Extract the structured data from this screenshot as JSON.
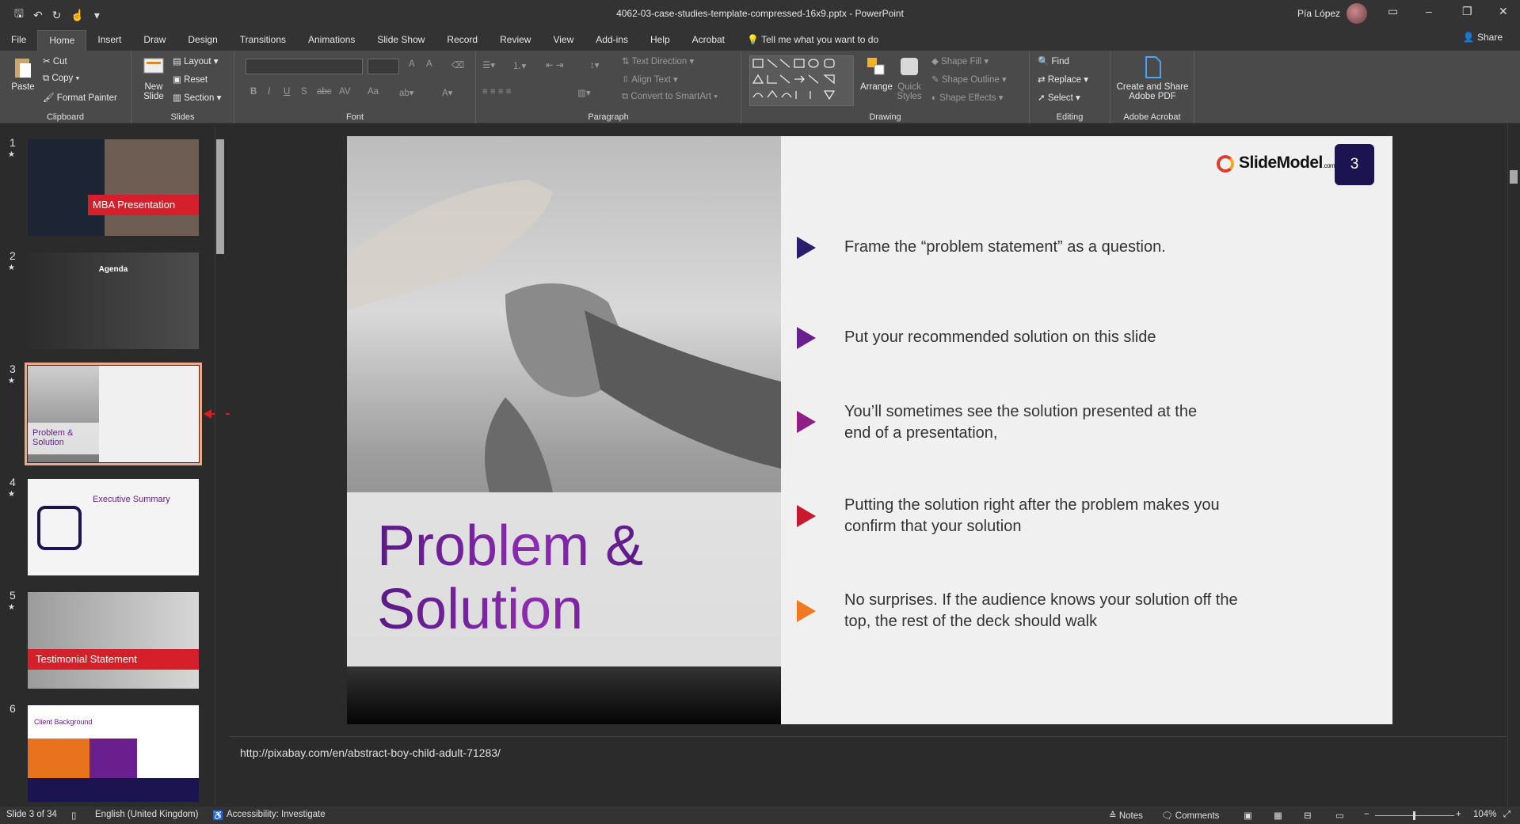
{
  "window": {
    "title": "4062-03-case-studies-template-compressed-16x9.pptx  -  PowerPoint",
    "user": "Pía López"
  },
  "tabs": [
    "File",
    "Home",
    "Insert",
    "Draw",
    "Design",
    "Transitions",
    "Animations",
    "Slide Show",
    "Record",
    "Review",
    "View",
    "Add-ins",
    "Help",
    "Acrobat"
  ],
  "tell_me": "Tell me what you want to do",
  "share": "Share",
  "ribbon": {
    "clipboard": {
      "paste": "Paste",
      "cut": "Cut",
      "copy": "Copy",
      "format_painter": "Format Painter",
      "label": "Clipboard"
    },
    "slides": {
      "new_slide": "New Slide",
      "layout": "Layout",
      "reset": "Reset",
      "section": "Section",
      "label": "Slides"
    },
    "font": {
      "label": "Font",
      "bold": "B",
      "italic": "I",
      "underline": "U",
      "shadow": "S",
      "strike": "abc",
      "spacing": "AV",
      "case": "Aa",
      "grow": "A",
      "shrink": "A"
    },
    "paragraph": {
      "text_direction": "Text Direction",
      "align_text": "Align Text",
      "convert": "Convert to SmartArt",
      "label": "Paragraph"
    },
    "drawing": {
      "arrange": "Arrange",
      "quick_styles": "Quick Styles",
      "shape_fill": "Shape Fill",
      "shape_outline": "Shape Outline",
      "shape_effects": "Shape Effects",
      "label": "Drawing"
    },
    "editing": {
      "find": "Find",
      "replace": "Replace",
      "select": "Select",
      "label": "Editing"
    },
    "acrobat": {
      "create": "Create and Share Adobe PDF",
      "label": "Adobe Acrobat"
    }
  },
  "thumbnails": [
    {
      "num": "1",
      "caption": "MBA Presentation"
    },
    {
      "num": "2",
      "caption": "Agenda"
    },
    {
      "num": "3",
      "caption": "Problem & Solution"
    },
    {
      "num": "4",
      "caption": "Executive Summary"
    },
    {
      "num": "5",
      "caption": "Testimonial Statement"
    },
    {
      "num": "6",
      "caption": "Client Background"
    }
  ],
  "slide": {
    "title_line1": "Problem &",
    "title_line2": "Solution",
    "logo": "SlideModel",
    "logo_suffix": ".com",
    "number": "3",
    "bullets": [
      {
        "text": "Frame the “problem statement” as a question.",
        "color": "#2a1d6e"
      },
      {
        "text": "Put your recommended solution on this slide",
        "color": "#6a1f8e"
      },
      {
        "text": "You’ll sometimes see the solution presented at the end of a presentation,",
        "color": "#8e1f86"
      },
      {
        "text": "Putting the solution right after the problem makes you confirm that your solution",
        "color": "#c8192e"
      },
      {
        "text": "No surprises. If the audience knows your solution off the top, the rest of the deck should walk",
        "color": "#ef7a23"
      }
    ]
  },
  "notes": "http://pixabay.com/en/abstract-boy-child-adult-71283/",
  "status": {
    "slide": "Slide 3 of 34",
    "language": "English (United Kingdom)",
    "accessibility": "Accessibility: Investigate",
    "notes": "Notes",
    "comments": "Comments",
    "zoom": "104%"
  }
}
